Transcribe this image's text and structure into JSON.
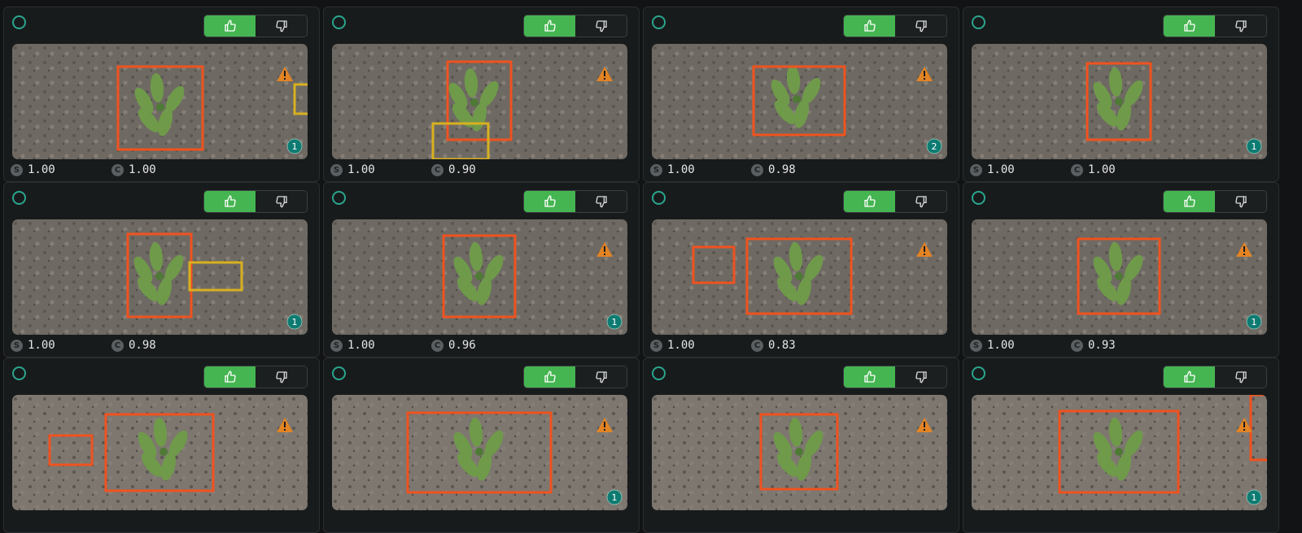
{
  "labels": {
    "score_chip": "S",
    "confidence_chip": "C"
  },
  "icons": {
    "select": "circle-outline-icon",
    "upvote": "thumbs-up-icon",
    "downvote": "thumbs-down-icon",
    "warning": "warning-triangle-icon"
  },
  "colors": {
    "accent": "#45b551",
    "box_primary": "#f0521f",
    "box_secondary": "#d8b020",
    "badge": "#0e7b72",
    "warning": "#e28324"
  },
  "cards": [
    {
      "score": "1.00",
      "confidence": "1.00",
      "count": "1",
      "warning": true
    },
    {
      "score": "1.00",
      "confidence": "0.90",
      "count": "",
      "warning": true
    },
    {
      "score": "1.00",
      "confidence": "0.98",
      "count": "2",
      "warning": true
    },
    {
      "score": "1.00",
      "confidence": "1.00",
      "count": "1",
      "warning": false
    },
    {
      "score": "1.00",
      "confidence": "0.98",
      "count": "1",
      "warning": false
    },
    {
      "score": "1.00",
      "confidence": "0.96",
      "count": "1",
      "warning": true
    },
    {
      "score": "1.00",
      "confidence": "0.83",
      "count": "",
      "warning": true
    },
    {
      "score": "1.00",
      "confidence": "0.93",
      "count": "1",
      "warning": true
    },
    {
      "score": "",
      "confidence": "",
      "count": "",
      "warning": true
    },
    {
      "score": "",
      "confidence": "",
      "count": "1",
      "warning": true
    },
    {
      "score": "",
      "confidence": "",
      "count": "",
      "warning": true
    },
    {
      "score": "",
      "confidence": "",
      "count": "1",
      "warning": true
    }
  ]
}
